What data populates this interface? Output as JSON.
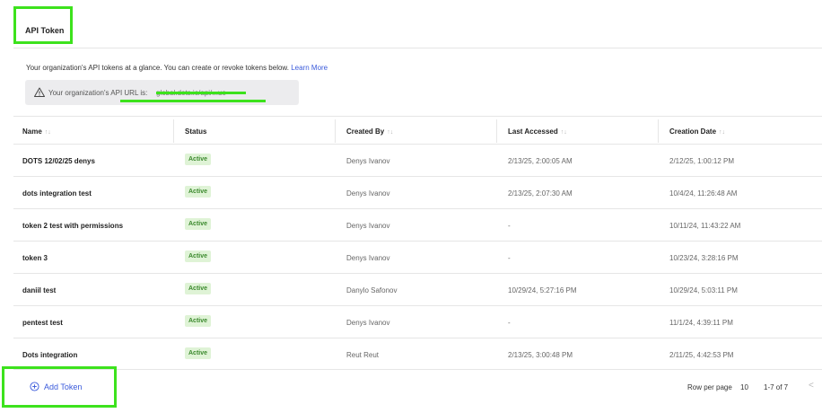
{
  "tab": {
    "label": "API Token"
  },
  "description": {
    "text": "Your organization's API tokens at a glance. You can create or revoke tokens below.",
    "link": "Learn More"
  },
  "api_url": {
    "label": "Your organization's API URL is:",
    "value": "global.dots.io/api/...ue",
    "icon": "warning-icon"
  },
  "table": {
    "columns": [
      {
        "label": "Name",
        "sortable": true
      },
      {
        "label": "Status",
        "sortable": false
      },
      {
        "label": "Created By",
        "sortable": true
      },
      {
        "label": "Last Accessed",
        "sortable": true
      },
      {
        "label": "Creation Date",
        "sortable": true
      }
    ],
    "sort_glyph": "↑↓",
    "rows": [
      {
        "name": "DOTS 12/02/25 denys",
        "status": "Active",
        "created_by": "Denys Ivanov",
        "last_accessed": "2/13/25, 2:00:05 AM",
        "creation_date": "2/12/25, 1:00:12 PM"
      },
      {
        "name": "dots integration test",
        "status": "Active",
        "created_by": "Denys Ivanov",
        "last_accessed": "2/13/25, 2:07:30 AM",
        "creation_date": "10/4/24, 11:26:48 AM"
      },
      {
        "name": "token 2 test with permissions",
        "status": "Active",
        "created_by": "Denys Ivanov",
        "last_accessed": "-",
        "creation_date": "10/11/24, 11:43:22 AM"
      },
      {
        "name": "token 3",
        "status": "Active",
        "created_by": "Denys Ivanov",
        "last_accessed": "-",
        "creation_date": "10/23/24, 3:28:16 PM"
      },
      {
        "name": "daniil test",
        "status": "Active",
        "created_by": "Danylo Safonov",
        "last_accessed": "10/29/24, 5:27:16 PM",
        "creation_date": "10/29/24, 5:03:11 PM"
      },
      {
        "name": "pentest test",
        "status": "Active",
        "created_by": "Denys Ivanov",
        "last_accessed": "-",
        "creation_date": "11/1/24, 4:39:11 PM"
      },
      {
        "name": "Dots integration",
        "status": "Active",
        "created_by": "Reut Reut",
        "last_accessed": "2/13/25, 3:00:48 PM",
        "creation_date": "2/11/25, 4:42:53 PM"
      }
    ]
  },
  "footer": {
    "add_label": "Add Token",
    "rows_per_page_label": "Row per page",
    "rows_per_page_value": "10",
    "range": "1-7 of 7",
    "prev_glyph": "<"
  },
  "colors": {
    "accent": "#3b5bdb",
    "highlight": "#3de21d",
    "badge_bg": "#dff3d6",
    "badge_text": "#3c8a2e"
  }
}
